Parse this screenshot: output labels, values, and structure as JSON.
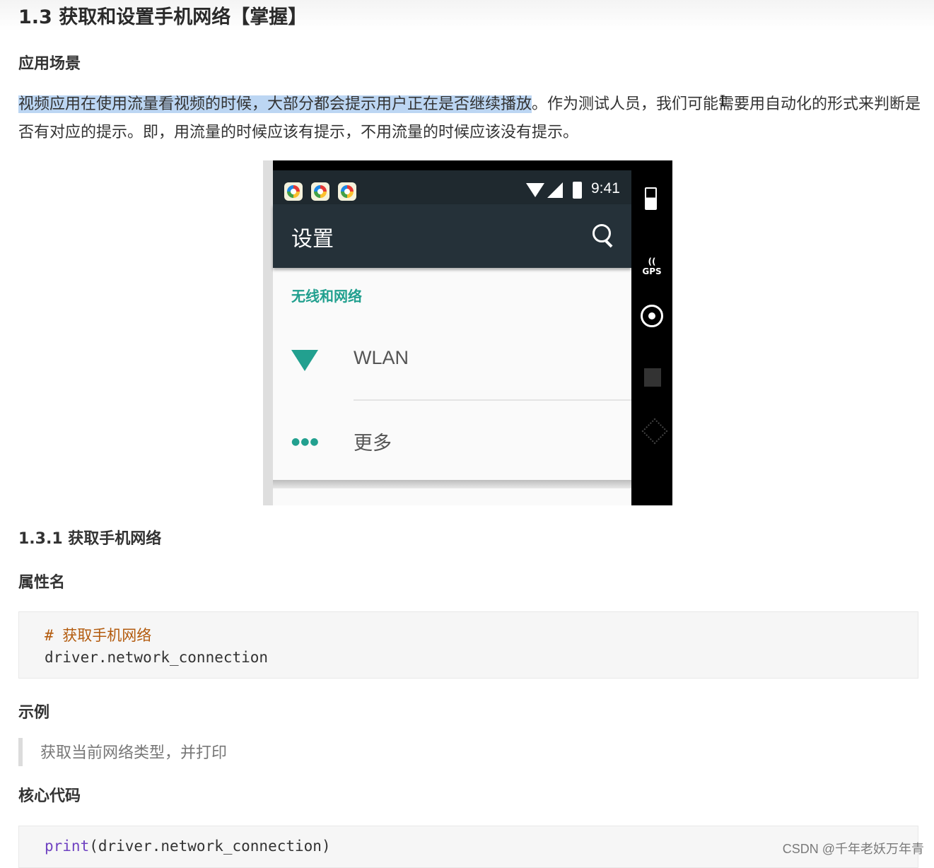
{
  "heading": "1.3 获取和设置手机网络【掌握】",
  "scenario": {
    "title": "应用场景",
    "highlighted": "视频应用在使用流量看视频的时候，大部分都会提示用户正在是否继续播放",
    "rest": "。作为测试人员，我们可能需要用自动化的形式来判断是否有对应的提示。即，用流量的时候应该有提示，不用流量的时候应该没有提示。"
  },
  "phone": {
    "time": "9:41",
    "title": "设置",
    "section": "无线和网络",
    "items": [
      {
        "icon": "wifi-icon",
        "label": "WLAN"
      },
      {
        "icon": "more-dots-icon",
        "label": "更多"
      }
    ],
    "side_gps_label": "GPS",
    "colors": {
      "toolbar": "#253139",
      "accent": "#22a08f"
    }
  },
  "sub": {
    "title": "1.3.1 获取手机网络",
    "attr_title": "属性名",
    "code1": {
      "comment": "# 获取手机网络",
      "line": "driver.network_connection"
    },
    "example_title": "示例",
    "quote": "获取当前网络类型，并打印",
    "core_title": "核心代码",
    "code2": {
      "fn": "print",
      "rest": "(driver.network_connection)"
    }
  },
  "watermark": "CSDN @千年老妖万年青"
}
